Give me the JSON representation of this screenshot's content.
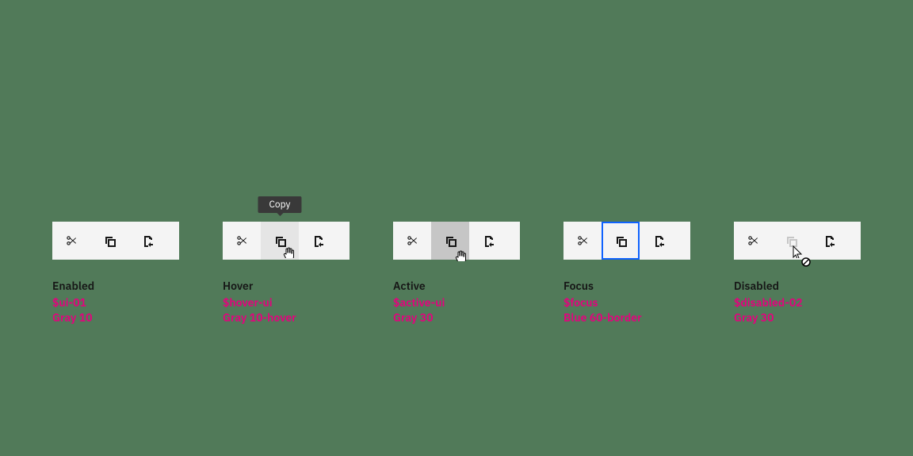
{
  "tooltip": "Copy",
  "states": [
    {
      "name": "Enabled",
      "token": "$ui-01",
      "desc": "Gray 10"
    },
    {
      "name": "Hover",
      "token": "$hover-ui",
      "desc": "Gray 10-hover"
    },
    {
      "name": "Active",
      "token": "$active-ui",
      "desc": "Gray 30"
    },
    {
      "name": "Focus",
      "token": "$focus",
      "desc": "Blue 60-border"
    },
    {
      "name": "Disabled",
      "token": "$disabled-02",
      "desc": "Gray 30"
    }
  ],
  "icons": [
    "cut-icon",
    "copy-icon",
    "paste-icon"
  ],
  "colors": {
    "bg": "#517a59",
    "toolbar": "#f4f4f4",
    "hover": "#e5e5e5",
    "active": "#c6c6c6",
    "focus": "#0f62fe",
    "token": "#e6007e"
  }
}
